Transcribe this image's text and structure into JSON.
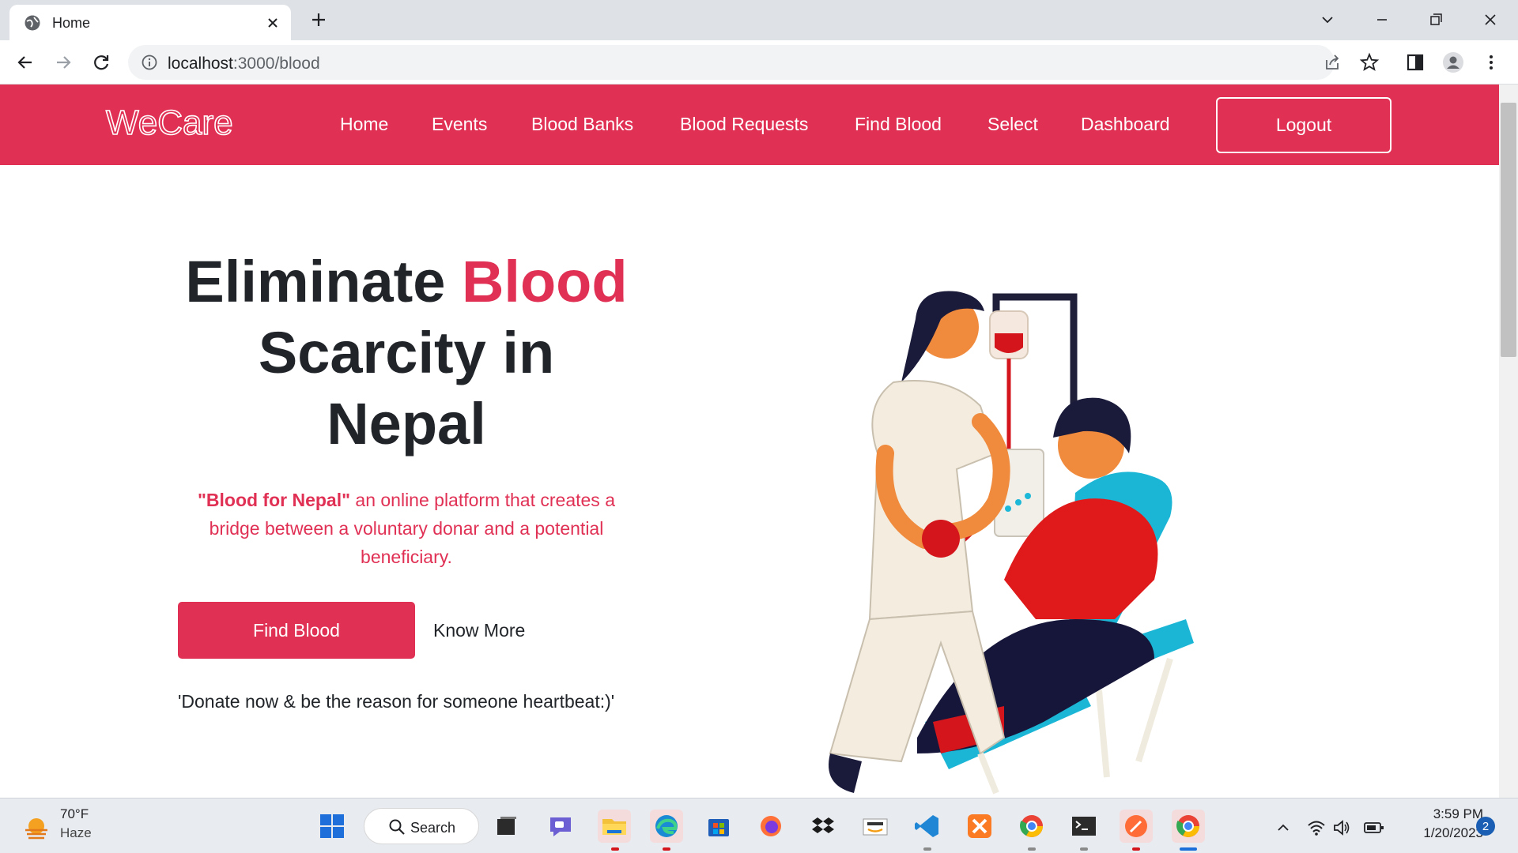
{
  "browser": {
    "tab_title": "Home",
    "url_host": "localhost",
    "url_path": ":3000/blood"
  },
  "nav": {
    "logo": "WeCare",
    "links": [
      "Home",
      "Events",
      "Blood Banks",
      "Blood Requests",
      "Find Blood",
      "Select",
      "Dashboard"
    ],
    "logout": "Logout"
  },
  "hero": {
    "headline_a": "Eliminate ",
    "headline_red": "Blood",
    "headline_b": "Scarcity in",
    "headline_c": "Nepal",
    "desc_bold": "\"Blood for Nepal\"",
    "desc_rest": " an online platform that creates a bridge between a voluntary donar and a potential beneficiary.",
    "find_button": "Find Blood",
    "know_more": "Know More",
    "quote": "'Donate now & be the reason for someone heartbeat:)'"
  },
  "taskbar": {
    "temperature": "70°F",
    "condition": "Haze",
    "search_label": "Search",
    "time": "3:59 PM",
    "date": "1/20/2023",
    "notification_count": "2"
  },
  "colors": {
    "brand": "#e03155",
    "text_dark": "#212529",
    "nav_text": "#ffffff"
  },
  "icons": [
    "globe-icon",
    "close-icon",
    "plus-icon",
    "chevron-down-icon",
    "minimize-icon",
    "restore-icon",
    "back-icon",
    "forward-icon",
    "reload-icon",
    "info-icon",
    "share-icon",
    "star-icon",
    "sidepanel-icon",
    "profile-icon",
    "more-icon",
    "windows-icon",
    "search-icon",
    "wifi-icon",
    "volume-icon",
    "battery-icon"
  ]
}
